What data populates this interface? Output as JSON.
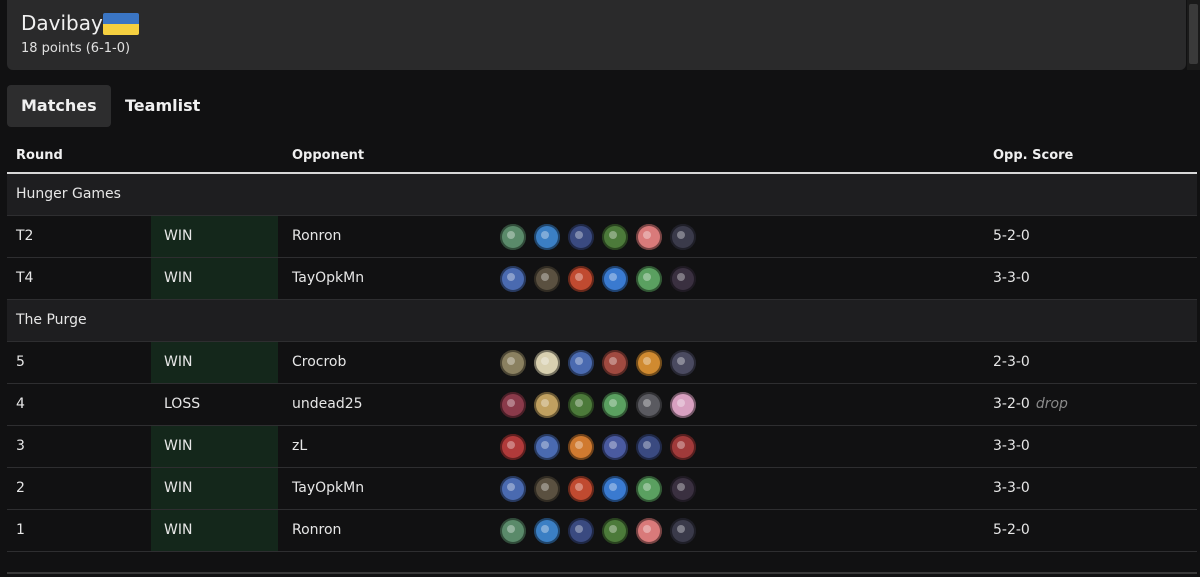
{
  "player": {
    "name": "Davibay",
    "flag": "ukraine-flag",
    "flag_colors": [
      "#3a75c4",
      "#f5d040"
    ],
    "points": "18 points (6-1-0)"
  },
  "tabs": [
    {
      "label": "Matches",
      "active": true
    },
    {
      "label": "Teamlist",
      "active": false
    }
  ],
  "table": {
    "headers": {
      "round": "Round",
      "opponent": "Opponent",
      "score": "Opp. Score"
    },
    "rows": [
      {
        "kind": "section",
        "label": "Hunger Games"
      },
      {
        "kind": "match",
        "round": "T2",
        "result": "WIN",
        "opponent": "Ronron",
        "score": "5-2-0",
        "note": "",
        "team": [
          "#5a8a6a",
          "#3b7fc4",
          "#3a4a80",
          "#4c7a3a",
          "#d97a7a",
          "#3a3a4a"
        ]
      },
      {
        "kind": "match",
        "round": "T4",
        "result": "WIN",
        "opponent": "TayOpkMn",
        "score": "3-3-0",
        "note": "",
        "team": [
          "#4a6ab0",
          "#5a5040",
          "#c04a30",
          "#3a7ad0",
          "#5aa060",
          "#3a3040"
        ]
      },
      {
        "kind": "section",
        "label": "The Purge"
      },
      {
        "kind": "match",
        "round": "5",
        "result": "WIN",
        "opponent": "Crocrob",
        "score": "2-3-0",
        "note": "",
        "team": [
          "#8a8060",
          "#d8d0b0",
          "#4a6ab0",
          "#a04a40",
          "#d08a30",
          "#4a4a60"
        ]
      },
      {
        "kind": "match",
        "round": "4",
        "result": "LOSS",
        "opponent": "undead25",
        "score": "3-2-0",
        "note": "drop",
        "team": [
          "#8a3a4a",
          "#c0a060",
          "#4c7a3a",
          "#5aa060",
          "#5a5a60",
          "#d8a0c0"
        ]
      },
      {
        "kind": "match",
        "round": "3",
        "result": "WIN",
        "opponent": "zL",
        "score": "3-3-0",
        "note": "",
        "team": [
          "#b03a3a",
          "#4a6ab0",
          "#d07a30",
          "#4a5aa0",
          "#3a4a80",
          "#a03a3a"
        ]
      },
      {
        "kind": "match",
        "round": "2",
        "result": "WIN",
        "opponent": "TayOpkMn",
        "score": "3-3-0",
        "note": "",
        "team": [
          "#4a6ab0",
          "#5a5040",
          "#c04a30",
          "#3a7ad0",
          "#5aa060",
          "#3a3040"
        ]
      },
      {
        "kind": "match",
        "round": "1",
        "result": "WIN",
        "opponent": "Ronron",
        "score": "5-2-0",
        "note": "",
        "team": [
          "#5a8a6a",
          "#3b7fc4",
          "#3a4a80",
          "#4c7a3a",
          "#d97a7a",
          "#3a3a4a"
        ]
      }
    ]
  },
  "colors": {
    "background": "#111112",
    "card": "#2a2a2b",
    "win_cell": "#14271b",
    "section_row": "#1e1e20"
  }
}
